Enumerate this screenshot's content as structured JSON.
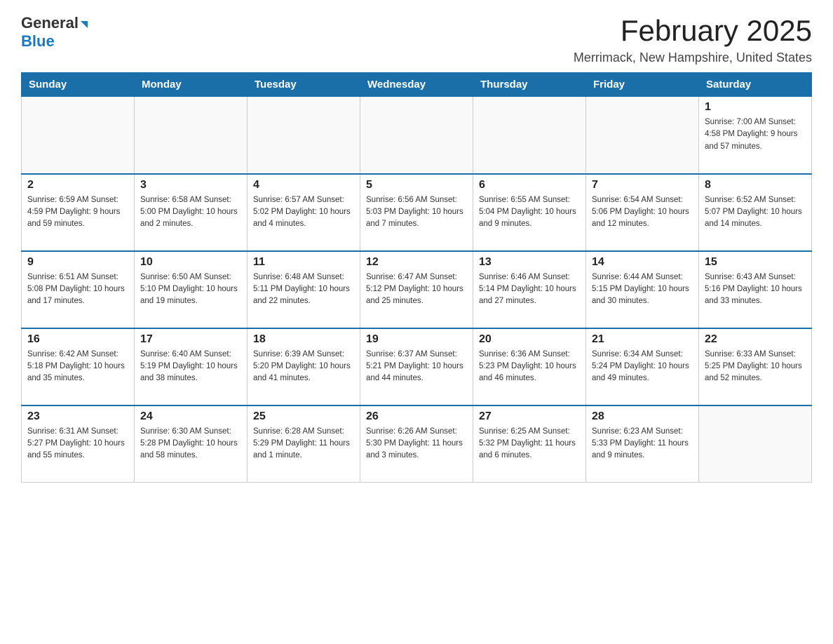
{
  "logo": {
    "general": "General",
    "arrow": "▶",
    "blue": "Blue"
  },
  "title": {
    "month": "February 2025",
    "location": "Merrimack, New Hampshire, United States"
  },
  "days_of_week": [
    "Sunday",
    "Monday",
    "Tuesday",
    "Wednesday",
    "Thursday",
    "Friday",
    "Saturday"
  ],
  "weeks": [
    [
      {
        "day": "",
        "info": ""
      },
      {
        "day": "",
        "info": ""
      },
      {
        "day": "",
        "info": ""
      },
      {
        "day": "",
        "info": ""
      },
      {
        "day": "",
        "info": ""
      },
      {
        "day": "",
        "info": ""
      },
      {
        "day": "1",
        "info": "Sunrise: 7:00 AM\nSunset: 4:58 PM\nDaylight: 9 hours and 57 minutes."
      }
    ],
    [
      {
        "day": "2",
        "info": "Sunrise: 6:59 AM\nSunset: 4:59 PM\nDaylight: 9 hours and 59 minutes."
      },
      {
        "day": "3",
        "info": "Sunrise: 6:58 AM\nSunset: 5:00 PM\nDaylight: 10 hours and 2 minutes."
      },
      {
        "day": "4",
        "info": "Sunrise: 6:57 AM\nSunset: 5:02 PM\nDaylight: 10 hours and 4 minutes."
      },
      {
        "day": "5",
        "info": "Sunrise: 6:56 AM\nSunset: 5:03 PM\nDaylight: 10 hours and 7 minutes."
      },
      {
        "day": "6",
        "info": "Sunrise: 6:55 AM\nSunset: 5:04 PM\nDaylight: 10 hours and 9 minutes."
      },
      {
        "day": "7",
        "info": "Sunrise: 6:54 AM\nSunset: 5:06 PM\nDaylight: 10 hours and 12 minutes."
      },
      {
        "day": "8",
        "info": "Sunrise: 6:52 AM\nSunset: 5:07 PM\nDaylight: 10 hours and 14 minutes."
      }
    ],
    [
      {
        "day": "9",
        "info": "Sunrise: 6:51 AM\nSunset: 5:08 PM\nDaylight: 10 hours and 17 minutes."
      },
      {
        "day": "10",
        "info": "Sunrise: 6:50 AM\nSunset: 5:10 PM\nDaylight: 10 hours and 19 minutes."
      },
      {
        "day": "11",
        "info": "Sunrise: 6:48 AM\nSunset: 5:11 PM\nDaylight: 10 hours and 22 minutes."
      },
      {
        "day": "12",
        "info": "Sunrise: 6:47 AM\nSunset: 5:12 PM\nDaylight: 10 hours and 25 minutes."
      },
      {
        "day": "13",
        "info": "Sunrise: 6:46 AM\nSunset: 5:14 PM\nDaylight: 10 hours and 27 minutes."
      },
      {
        "day": "14",
        "info": "Sunrise: 6:44 AM\nSunset: 5:15 PM\nDaylight: 10 hours and 30 minutes."
      },
      {
        "day": "15",
        "info": "Sunrise: 6:43 AM\nSunset: 5:16 PM\nDaylight: 10 hours and 33 minutes."
      }
    ],
    [
      {
        "day": "16",
        "info": "Sunrise: 6:42 AM\nSunset: 5:18 PM\nDaylight: 10 hours and 35 minutes."
      },
      {
        "day": "17",
        "info": "Sunrise: 6:40 AM\nSunset: 5:19 PM\nDaylight: 10 hours and 38 minutes."
      },
      {
        "day": "18",
        "info": "Sunrise: 6:39 AM\nSunset: 5:20 PM\nDaylight: 10 hours and 41 minutes."
      },
      {
        "day": "19",
        "info": "Sunrise: 6:37 AM\nSunset: 5:21 PM\nDaylight: 10 hours and 44 minutes."
      },
      {
        "day": "20",
        "info": "Sunrise: 6:36 AM\nSunset: 5:23 PM\nDaylight: 10 hours and 46 minutes."
      },
      {
        "day": "21",
        "info": "Sunrise: 6:34 AM\nSunset: 5:24 PM\nDaylight: 10 hours and 49 minutes."
      },
      {
        "day": "22",
        "info": "Sunrise: 6:33 AM\nSunset: 5:25 PM\nDaylight: 10 hours and 52 minutes."
      }
    ],
    [
      {
        "day": "23",
        "info": "Sunrise: 6:31 AM\nSunset: 5:27 PM\nDaylight: 10 hours and 55 minutes."
      },
      {
        "day": "24",
        "info": "Sunrise: 6:30 AM\nSunset: 5:28 PM\nDaylight: 10 hours and 58 minutes."
      },
      {
        "day": "25",
        "info": "Sunrise: 6:28 AM\nSunset: 5:29 PM\nDaylight: 11 hours and 1 minute."
      },
      {
        "day": "26",
        "info": "Sunrise: 6:26 AM\nSunset: 5:30 PM\nDaylight: 11 hours and 3 minutes."
      },
      {
        "day": "27",
        "info": "Sunrise: 6:25 AM\nSunset: 5:32 PM\nDaylight: 11 hours and 6 minutes."
      },
      {
        "day": "28",
        "info": "Sunrise: 6:23 AM\nSunset: 5:33 PM\nDaylight: 11 hours and 9 minutes."
      },
      {
        "day": "",
        "info": ""
      }
    ]
  ]
}
